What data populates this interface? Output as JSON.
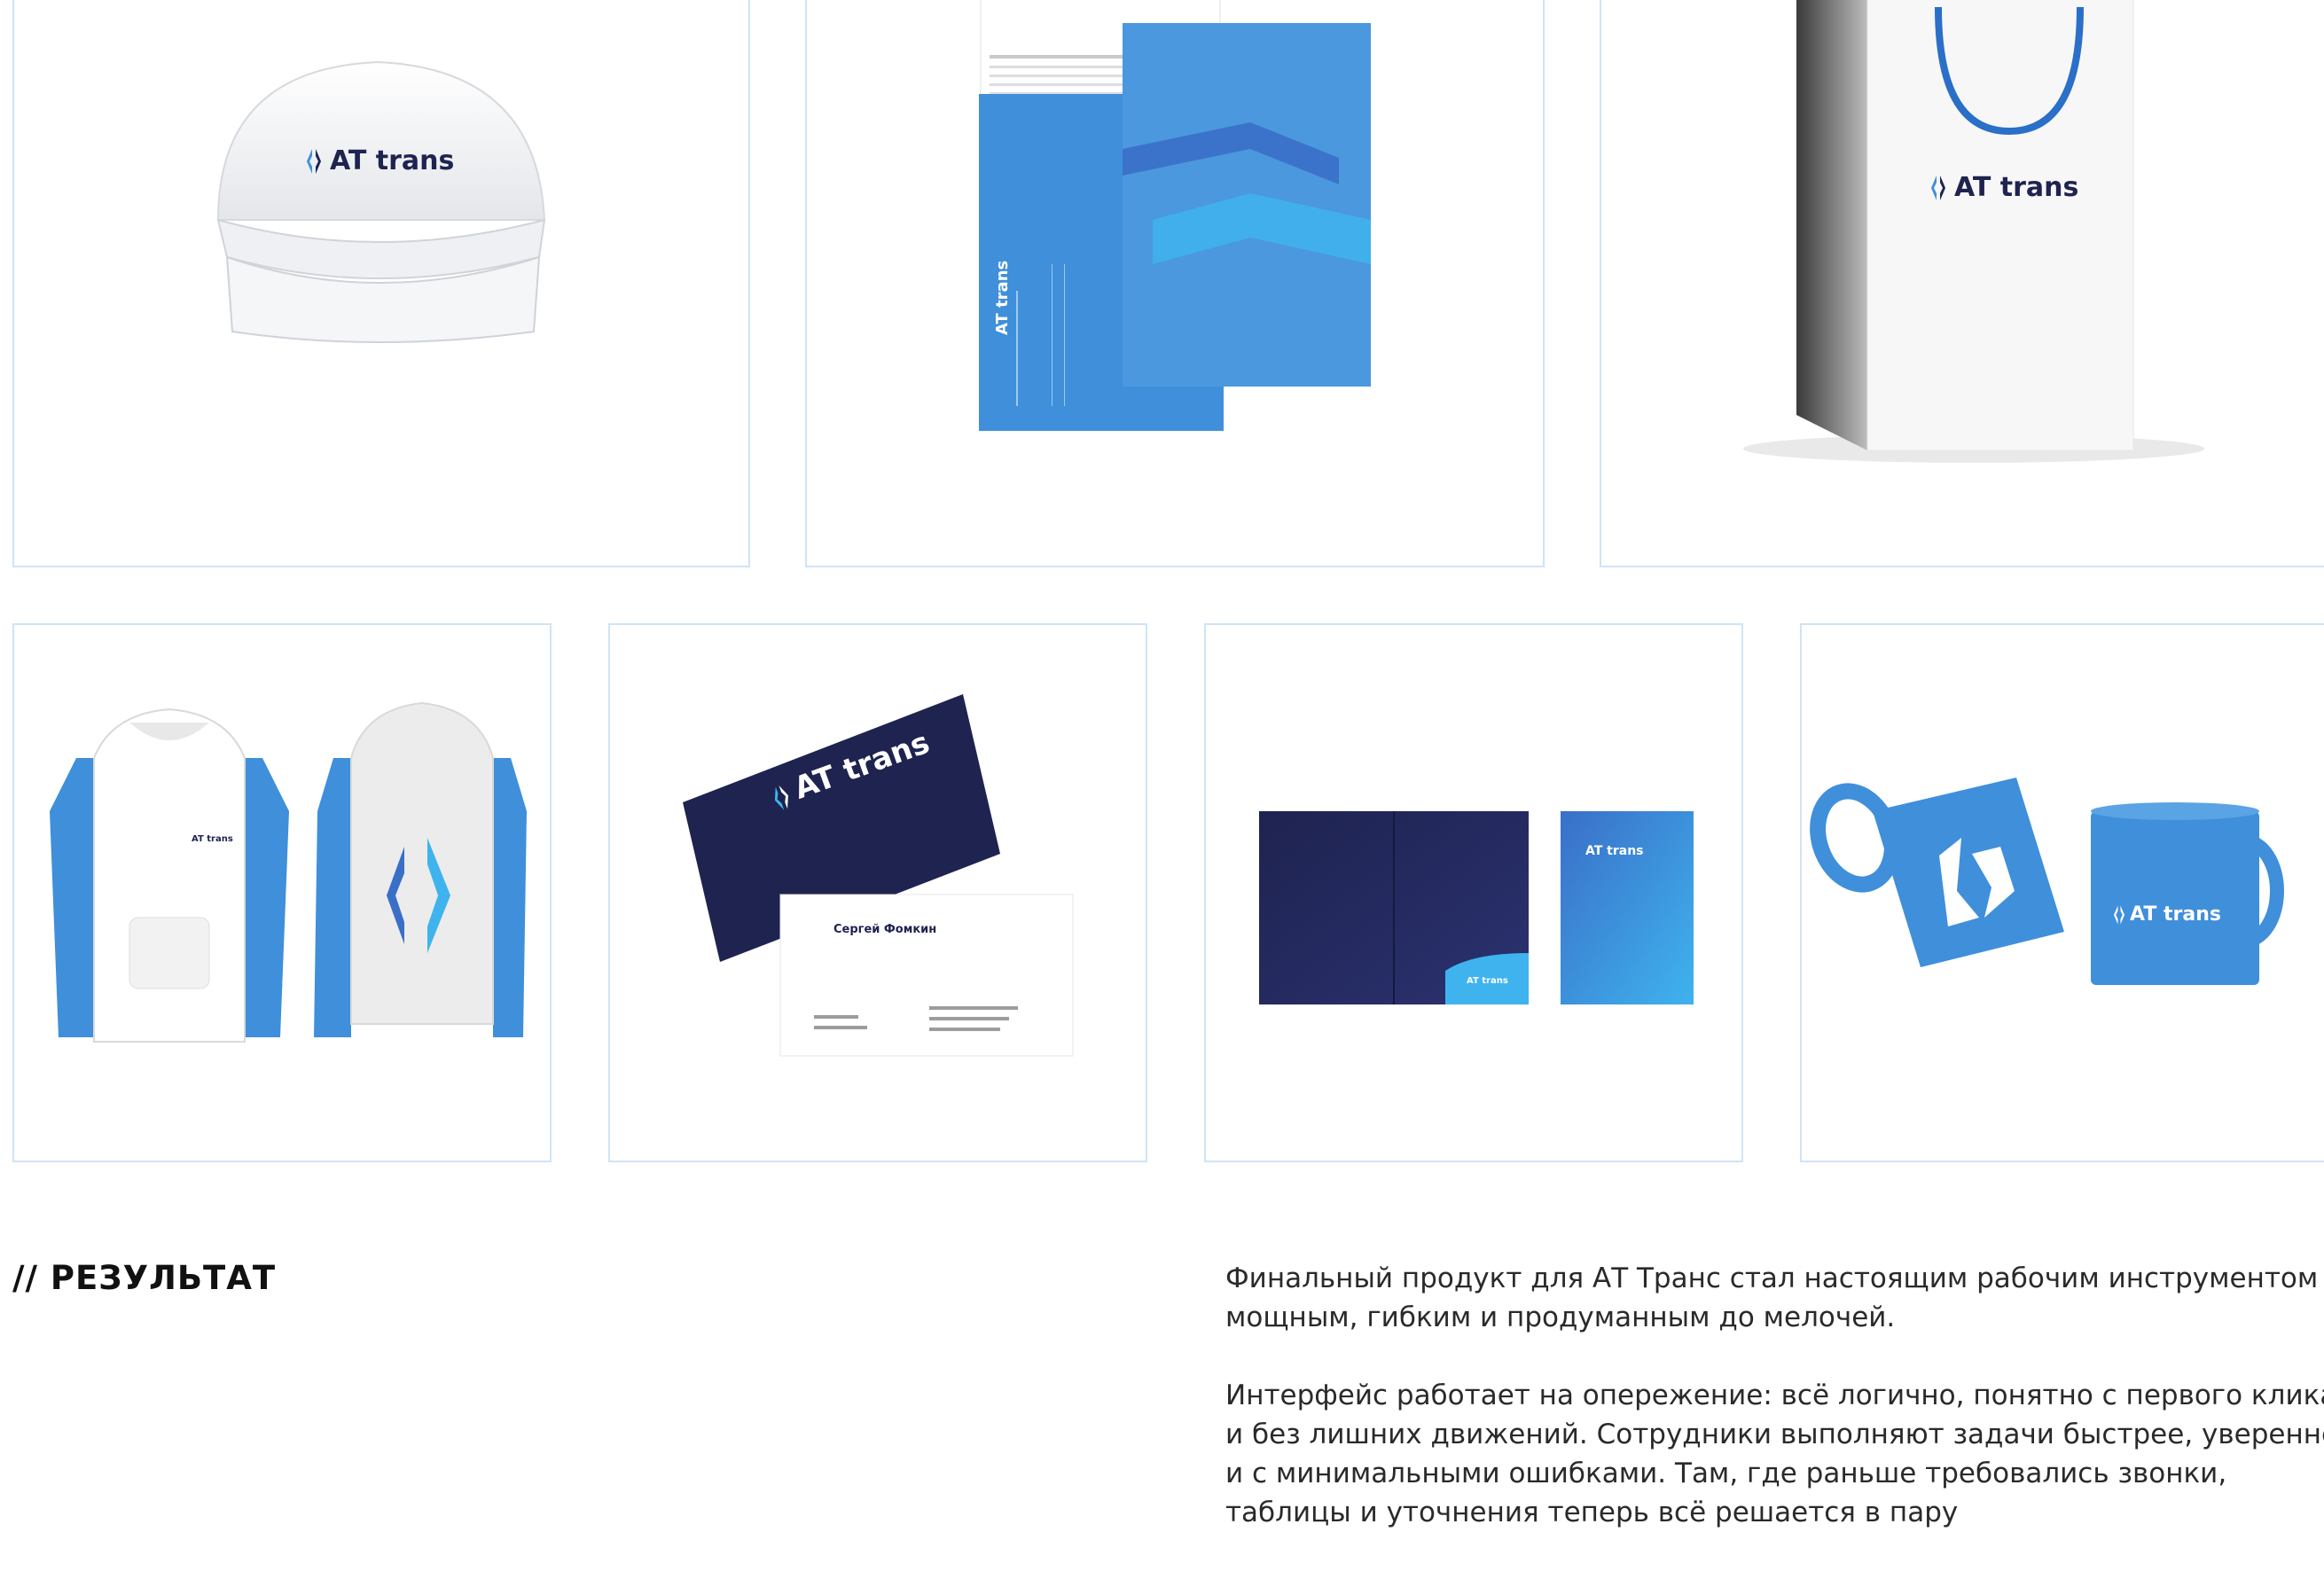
{
  "brand": {
    "name": "AT trans"
  },
  "gallery": {
    "row1": [
      {
        "id": "cap",
        "logo": "AT trans"
      },
      {
        "id": "stationery",
        "logo": "AT trans"
      },
      {
        "id": "bag",
        "logo": "AT trans"
      }
    ],
    "row2": [
      {
        "id": "hoodies",
        "logo": "AT trans"
      },
      {
        "id": "business-cards",
        "logo": "AT trans",
        "person_name": "Сергей Фомкин"
      },
      {
        "id": "folder",
        "logo": "AT trans"
      },
      {
        "id": "mugs",
        "logo": "AT trans"
      }
    ]
  },
  "result": {
    "title": "// РЕЗУЛЬТАТ",
    "paragraphs": [
      "Финальный продукт для АТ Транс стал настоящим рабочим инструментом — мощным, гибким и продуманным до мелочей.",
      "Интерфейс работает на опережение: всё логично, понятно с первого клика и без лишних движений. Сотрудники выполняют задачи быстрее, увереннее и с минимальными ошибками. Там, где раньше требовались звонки, таблицы и уточнения теперь всё решается в пару"
    ]
  },
  "colors": {
    "card_border": "#cfe4f7",
    "brand_blue": "#3f8fdb",
    "brand_navy": "#1e2350",
    "accent_light": "#3fb3ee"
  },
  "icons": [
    "at-trans-logo-mark"
  ]
}
